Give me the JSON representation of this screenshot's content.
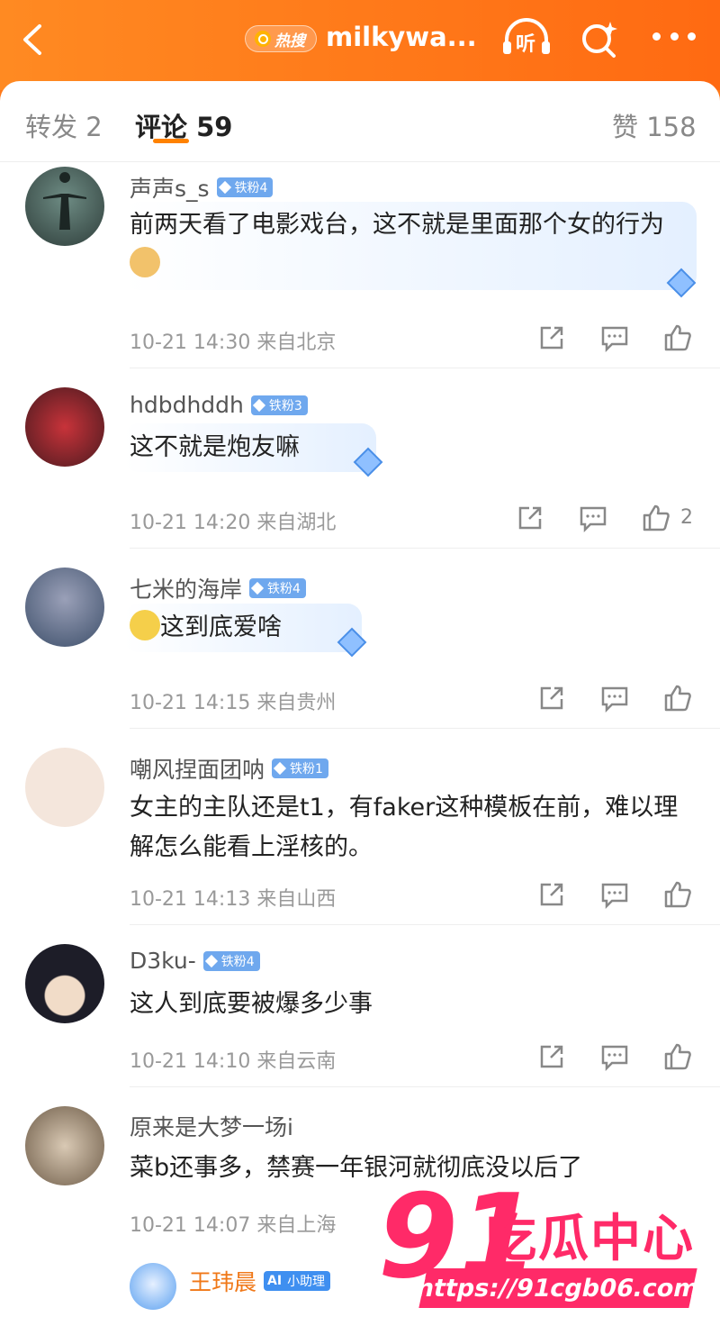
{
  "header": {
    "hot_search_label": "热搜",
    "title": "milkywa...",
    "listen_label": "听"
  },
  "tabs": [
    {
      "label": "转发 2"
    },
    {
      "label": "评论 59"
    },
    {
      "label": "赞 158"
    }
  ],
  "comments": [
    {
      "user": "声声s_s",
      "badge": "铁粉4",
      "text": "前两天看了电影戏台，这不就是里面那个女的行为",
      "time": "10-21 14:30",
      "location": "来自北京",
      "likes": ""
    },
    {
      "user": "hdbdhddh",
      "badge": "铁粉3",
      "text": "这不就是炮友嘛",
      "time": "10-21 14:20",
      "location": "来自湖北",
      "likes": "2"
    },
    {
      "user": "七米的海岸",
      "badge": "铁粉4",
      "text": "这到底爱啥",
      "time": "10-21 14:15",
      "location": "来自贵州",
      "likes": ""
    },
    {
      "user": "嘲风捏面团呐",
      "badge": "铁粉1",
      "text": "女主的主队还是t1，有faker这种模板在前，难以理解怎么能看上淫核的。",
      "time": "10-21 14:13",
      "location": "来自山西",
      "likes": ""
    },
    {
      "user": "D3ku-",
      "badge": "铁粉4",
      "text": "这人到底要被爆多少事",
      "time": "10-21 14:10",
      "location": "来自云南",
      "likes": ""
    },
    {
      "user": "原来是大梦一场i",
      "badge": "",
      "text": "菜b还事多，禁赛一年银河就彻底没以后了",
      "time": "10-21 14:07",
      "location": "来自上海",
      "likes": ""
    }
  ],
  "reply": {
    "user": "王玮晨",
    "badge": "小助理"
  },
  "watermark": {
    "number": "91",
    "name": "吃瓜中心",
    "url": "https://91cgb06.com"
  },
  "colors": {
    "brand_orange": "#ff7a1a",
    "badge_blue": "#6fa8ee",
    "watermark_pink": "#ff2a68"
  }
}
